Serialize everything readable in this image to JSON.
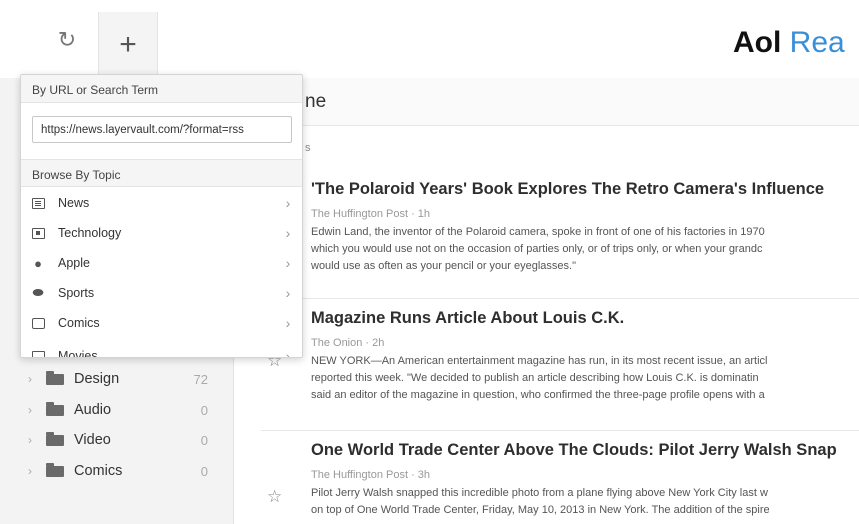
{
  "topbar": {
    "refresh_icon": "refresh-icon",
    "add_icon": "plus-icon",
    "logo_bold": "Aol",
    "logo_light": "Rea"
  },
  "sidebar": {
    "folders": [
      {
        "name": "Design",
        "count": "72"
      },
      {
        "name": "Audio",
        "count": "0"
      },
      {
        "name": "Video",
        "count": "0"
      },
      {
        "name": "Comics",
        "count": "0"
      }
    ]
  },
  "main": {
    "title": "ne",
    "subtitle": "s",
    "articles": [
      {
        "title": "'The Polaroid Years' Book Explores The Retro Camera's Influence",
        "meta": "The Huffington Post · 1h",
        "summary": [
          "Edwin Land, the inventor of the Polaroid camera, spoke in front of one of his factories in 1970",
          "which you would use not on the occasion of parties only, or of trips only, or when your grandc",
          "would use as often as your pencil or your eyeglasses.\""
        ]
      },
      {
        "title": "Magazine Runs Article About Louis C.K.",
        "meta": "The Onion · 2h",
        "summary": [
          "NEW YORK—An American entertainment magazine has run, in its most recent issue, an articl",
          "reported this week. \"We decided to publish an article describing how Louis C.K. is dominatin",
          "said an editor of the magazine in question, who confirmed the three-page profile opens with a"
        ]
      },
      {
        "title": "One World Trade Center Above The Clouds: Pilot Jerry Walsh Snap",
        "meta": "The Huffington Post · 3h",
        "summary": [
          "Pilot Jerry Walsh snapped this incredible photo from a plane flying above New York City last w",
          "on top of One World Trade Center, Friday, May 10, 2013 in New York. The addition of the spire"
        ]
      }
    ]
  },
  "popover": {
    "url_section_label": "By URL or Search Term",
    "url_value": "https://news.layervault.com/?format=rss",
    "browse_section_label": "Browse By Topic",
    "topics": [
      {
        "label": "News",
        "icon": "newspaper-icon"
      },
      {
        "label": "Technology",
        "icon": "chip-icon"
      },
      {
        "label": "Apple",
        "icon": "apple-icon"
      },
      {
        "label": "Sports",
        "icon": "football-icon"
      },
      {
        "label": "Comics",
        "icon": "speech-bubble-icon"
      },
      {
        "label": "Movies",
        "icon": "film-icon"
      }
    ]
  }
}
